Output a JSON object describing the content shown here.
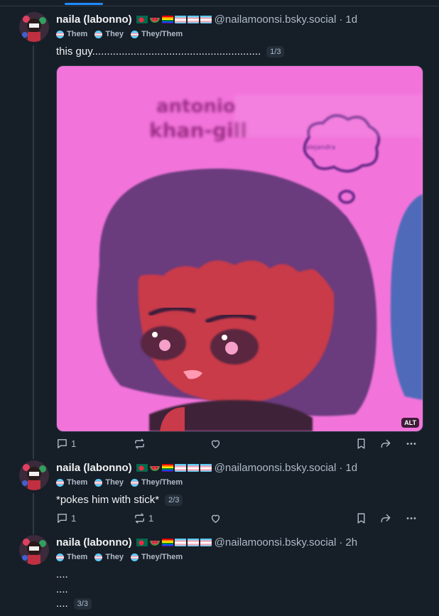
{
  "posts": [
    {
      "display_name": "naila (labonno)",
      "handle": "@nailamoonsi.bsky.social",
      "time": "1d",
      "pronouns": [
        "Them",
        "They",
        "They/Them"
      ],
      "text_lines": [
        "this guy........................................................."
      ],
      "counter": "1/3",
      "image": {
        "alt_badge": "ALT",
        "drawn_text": [
          "antonio",
          "khan-gill",
          "alejandra"
        ],
        "background_color": "#f06ad8"
      },
      "actions": {
        "reply_count": "1",
        "repost_count": ""
      }
    },
    {
      "display_name": "naila (labonno)",
      "handle": "@nailamoonsi.bsky.social",
      "time": "1d",
      "pronouns": [
        "Them",
        "They",
        "They/Them"
      ],
      "text_lines": [
        "*pokes him with stick*"
      ],
      "counter": "2/3",
      "actions": {
        "reply_count": "1",
        "repost_count": "1"
      }
    },
    {
      "display_name": "naila (labonno)",
      "handle": "@nailamoonsi.bsky.social",
      "time": "2h",
      "pronouns": [
        "Them",
        "They",
        "They/Them"
      ],
      "text_lines": [
        "....",
        "....",
        "...."
      ],
      "counter": "3/3"
    }
  ],
  "icons": [
    "reply-icon",
    "repost-icon",
    "like-icon",
    "bookmark-icon",
    "share-icon",
    "more-icon"
  ],
  "colors": {
    "background": "#161e27",
    "muted_text": "#aebbc9",
    "accent": "#208bfe",
    "thread_line": "#2e3a48"
  }
}
